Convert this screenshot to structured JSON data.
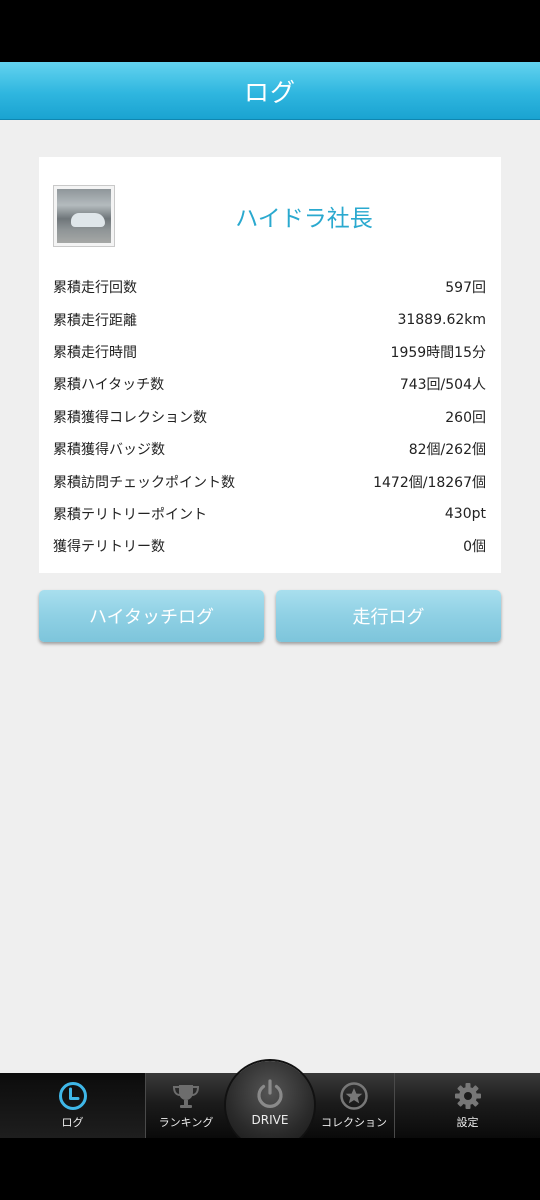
{
  "header": {
    "title": "ログ"
  },
  "profile": {
    "name": "ハイドラ社長"
  },
  "stats": [
    {
      "label": "累積走行回数",
      "value": "597回"
    },
    {
      "label": "累積走行距離",
      "value": "31889.62km"
    },
    {
      "label": "累積走行時間",
      "value": "1959時間15分"
    },
    {
      "label": "累積ハイタッチ数",
      "value": "743回/504人"
    },
    {
      "label": "累積獲得コレクション数",
      "value": "260回"
    },
    {
      "label": "累積獲得バッジ数",
      "value": "82個/262個"
    },
    {
      "label": "累積訪問チェックポイント数",
      "value": "1472個/18267個"
    },
    {
      "label": "累積テリトリーポイント",
      "value": "430pt"
    },
    {
      "label": "獲得テリトリー数",
      "value": "0個"
    }
  ],
  "buttons": {
    "hightouch_log": "ハイタッチログ",
    "drive_log": "走行ログ"
  },
  "tabbar": {
    "log": "ログ",
    "ranking": "ランキング",
    "drive": "DRIVE",
    "collection": "コレクション",
    "settings": "設定"
  },
  "colors": {
    "accent": "#2aa9cf",
    "active_icon": "#3fb7e8"
  }
}
